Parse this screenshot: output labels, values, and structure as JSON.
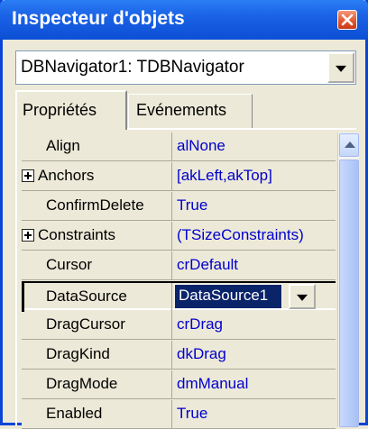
{
  "window": {
    "title": "Inspecteur d'objets"
  },
  "object_selector": {
    "value": "DBNavigator1: TDBNavigator"
  },
  "tabs": [
    {
      "label": "Propriétés",
      "active": true
    },
    {
      "label": "Evénements",
      "active": false
    }
  ],
  "properties": [
    {
      "name": "Align",
      "value": "alNone",
      "expandable": false
    },
    {
      "name": "Anchors",
      "value": "[akLeft,akTop]",
      "expandable": true
    },
    {
      "name": "ConfirmDelete",
      "value": "True",
      "expandable": false
    },
    {
      "name": "Constraints",
      "value": "(TSizeConstraints)",
      "expandable": true
    },
    {
      "name": "Cursor",
      "value": "crDefault",
      "expandable": false
    },
    {
      "name": "DataSource",
      "value": "DataSource1",
      "expandable": false,
      "selected": true
    },
    {
      "name": "DragCursor",
      "value": "crDrag",
      "expandable": false
    },
    {
      "name": "DragKind",
      "value": "dkDrag",
      "expandable": false
    },
    {
      "name": "DragMode",
      "value": "dmManual",
      "expandable": false
    },
    {
      "name": "Enabled",
      "value": "True",
      "expandable": false
    }
  ],
  "colors": {
    "titlebar": "#0c4fd4",
    "value_text": "#0000ce",
    "selection": "#0a246a"
  }
}
